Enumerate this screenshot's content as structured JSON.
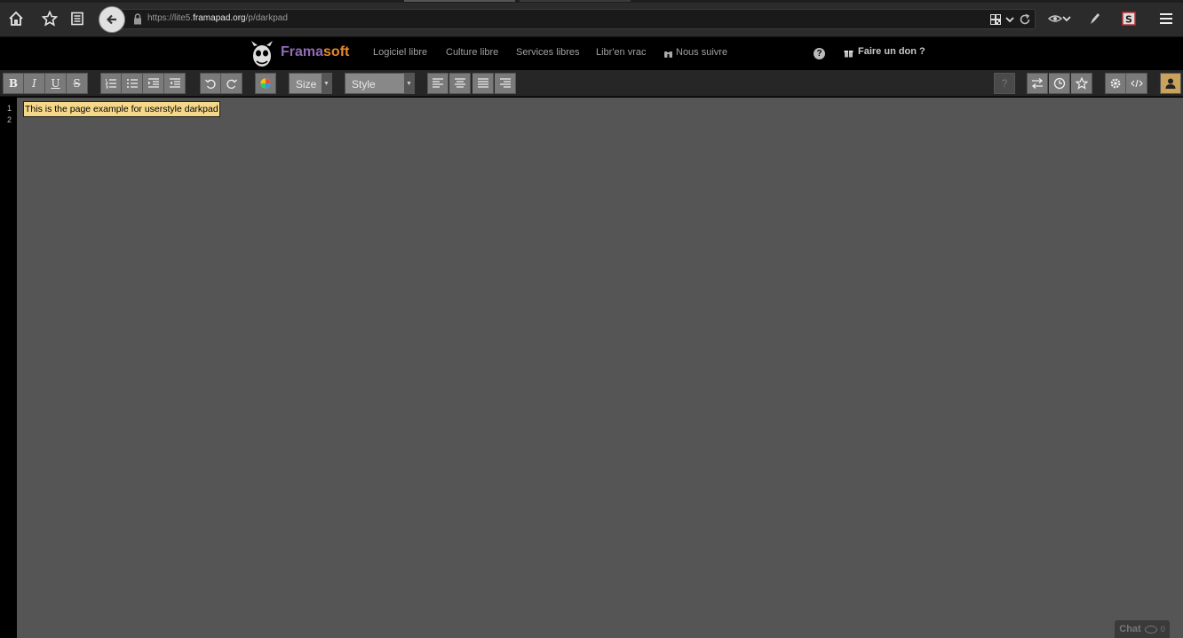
{
  "browser": {
    "url_prefix": "https://lite5.",
    "url_host": "framapad.org",
    "url_path": "/p/darkpad"
  },
  "framanav": {
    "brand_part1": "Frama",
    "brand_part2": "soft",
    "links": [
      "Logiciel libre",
      "Culture libre",
      "Services libres",
      "Libr'en vrac",
      "Nous suivre"
    ],
    "help": "?",
    "donate": "Faire un don ?"
  },
  "toolbar": {
    "bold": "B",
    "italic": "I",
    "underline": "U",
    "strike": "S",
    "size_label": "Size",
    "style_label": "Style",
    "help": "?"
  },
  "editor": {
    "line_numbers": [
      "1",
      "2"
    ],
    "lines": [
      "This is the page example for userstyle darkpad"
    ]
  },
  "chat": {
    "label": "Chat",
    "count": "0"
  },
  "colors": {
    "brand_purple": "#8e6cb7",
    "brand_orange": "#e8892b",
    "editor_bg": "#555555",
    "line_highlight": "#f5d88a",
    "user_button": "#c9a35c"
  }
}
